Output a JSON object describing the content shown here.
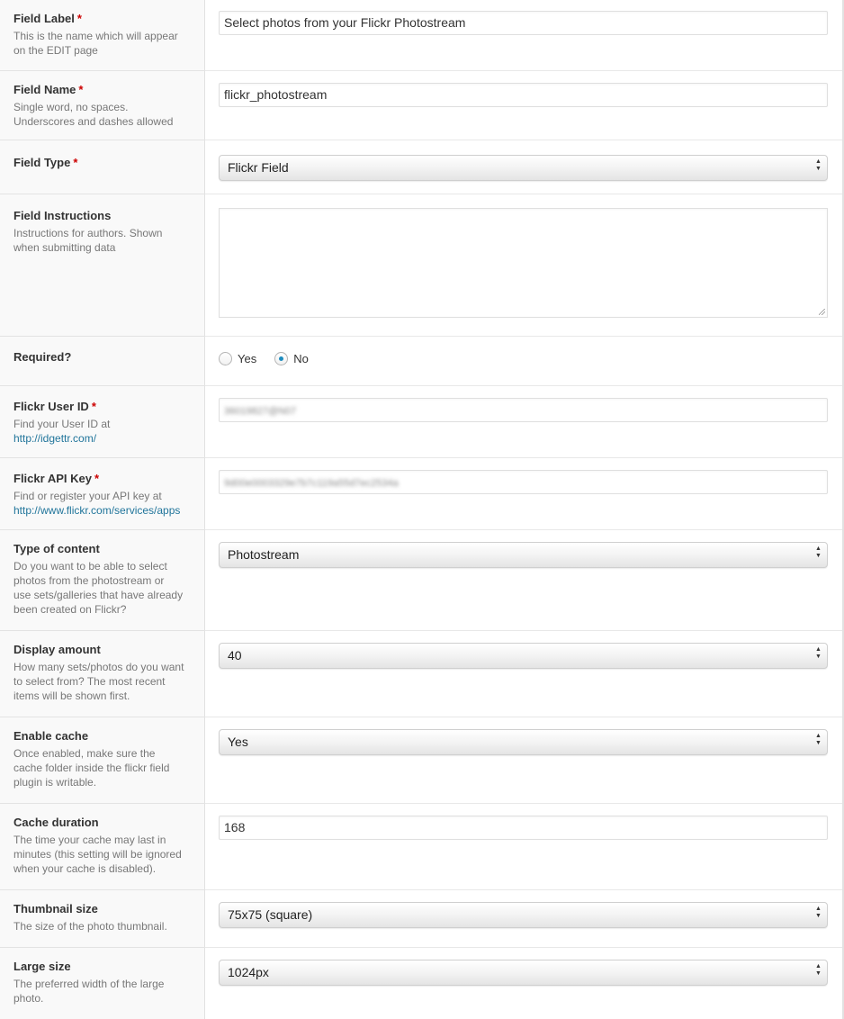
{
  "fields": {
    "field_label": {
      "label": "Field Label",
      "required_mark": "*",
      "desc": [
        "This is the name which will appear",
        "on the EDIT page"
      ],
      "value": "Select photos from your Flickr Photostream"
    },
    "field_name": {
      "label": "Field Name",
      "required_mark": "*",
      "desc": [
        "Single word, no spaces.",
        "Underscores and dashes allowed"
      ],
      "value": "flickr_photostream"
    },
    "field_type": {
      "label": "Field Type",
      "required_mark": "*",
      "value": "Flickr Field"
    },
    "field_instructions": {
      "label": "Field Instructions",
      "desc": [
        "Instructions for authors. Shown",
        "when submitting data"
      ],
      "value": ""
    },
    "required": {
      "label": "Required?",
      "options": [
        "Yes",
        "No"
      ],
      "selected": "No"
    },
    "flickr_user_id": {
      "label": "Flickr User ID",
      "required_mark": "*",
      "desc": [
        "Find your User ID at"
      ],
      "link": "http://idgettr.com/",
      "value": "36019827@N07"
    },
    "flickr_api_key": {
      "label": "Flickr API Key",
      "required_mark": "*",
      "desc": [
        "Find or register your API key at"
      ],
      "link": "http://www.flickr.com/services/apps",
      "value": "9d00e0003329e7b7c119a55d7ec2534a"
    },
    "type_of_content": {
      "label": "Type of content",
      "desc": [
        "Do you want to be able to select",
        "photos from the photostream or",
        "use sets/galleries that have already",
        "been created on Flickr?"
      ],
      "value": "Photostream"
    },
    "display_amount": {
      "label": "Display amount",
      "desc": [
        "How many sets/photos do you want",
        "to select from? The most recent",
        "items will be shown first."
      ],
      "value": "40"
    },
    "enable_cache": {
      "label": "Enable cache",
      "desc": [
        "Once enabled, make sure the",
        "cache folder inside the flickr field",
        "plugin is writable."
      ],
      "value": "Yes"
    },
    "cache_duration": {
      "label": "Cache duration",
      "desc": [
        "The time your cache may last in",
        "minutes (this setting will be ignored",
        "when your cache is disabled)."
      ],
      "value": "168"
    },
    "thumbnail_size": {
      "label": "Thumbnail size",
      "desc": [
        "The size of the photo thumbnail."
      ],
      "value": "75x75 (square)"
    },
    "large_size": {
      "label": "Large size",
      "desc": [
        "The preferred width of the large",
        "photo."
      ],
      "value": "1024px"
    }
  }
}
